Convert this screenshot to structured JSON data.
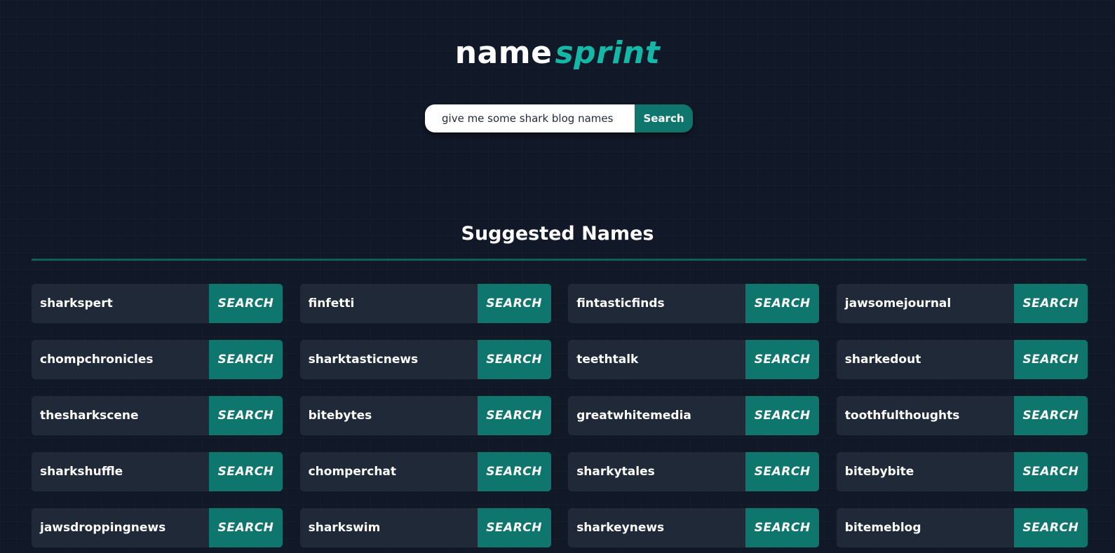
{
  "logo": {
    "first": "name",
    "second": "sprint"
  },
  "search": {
    "value": "give me some shark blog names",
    "button_label": "Search"
  },
  "section": {
    "title": "Suggested Names"
  },
  "card_button_label": "SEARCH",
  "names": [
    "sharkspert",
    "finfetti",
    "fintasticfinds",
    "jawsomejournal",
    "chompchronicles",
    "sharktasticnews",
    "teethtalk",
    "sharkedout",
    "thesharkscene",
    "bitebytes",
    "greatwhitemedia",
    "toothfulthoughts",
    "sharkshuffle",
    "chomperchat",
    "sharkytales",
    "bitebybite",
    "jawsdroppingnews",
    "sharkswim",
    "sharkeynews",
    "bitemeblog"
  ],
  "colors": {
    "background": "#111827",
    "accent": "#14b8a6",
    "button": "#0f766e",
    "card": "#1f2937"
  }
}
